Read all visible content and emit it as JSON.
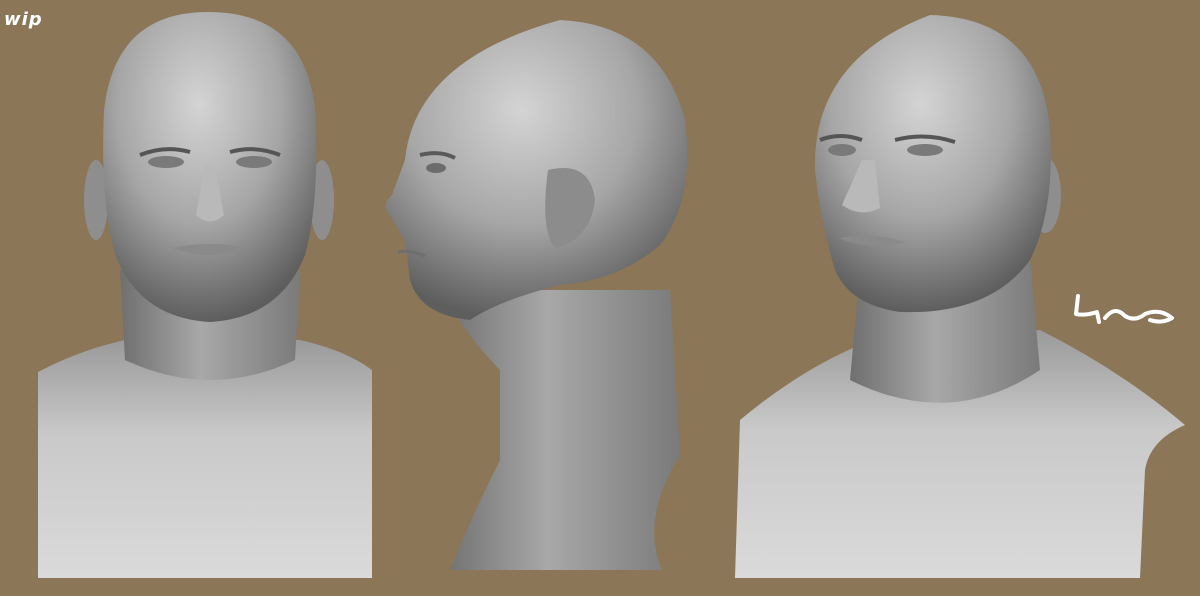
{
  "canvas": {
    "background": "#8c7658",
    "sculpt_color": "#a7a7a7"
  },
  "labels": {
    "wip": "wip"
  },
  "views": [
    {
      "name": "front",
      "description_icon": "head-front"
    },
    {
      "name": "profile",
      "description_icon": "head-side"
    },
    {
      "name": "three-quarter",
      "description_icon": "head-three-quarter"
    }
  ],
  "signature": {
    "icon": "handwritten-signature"
  }
}
